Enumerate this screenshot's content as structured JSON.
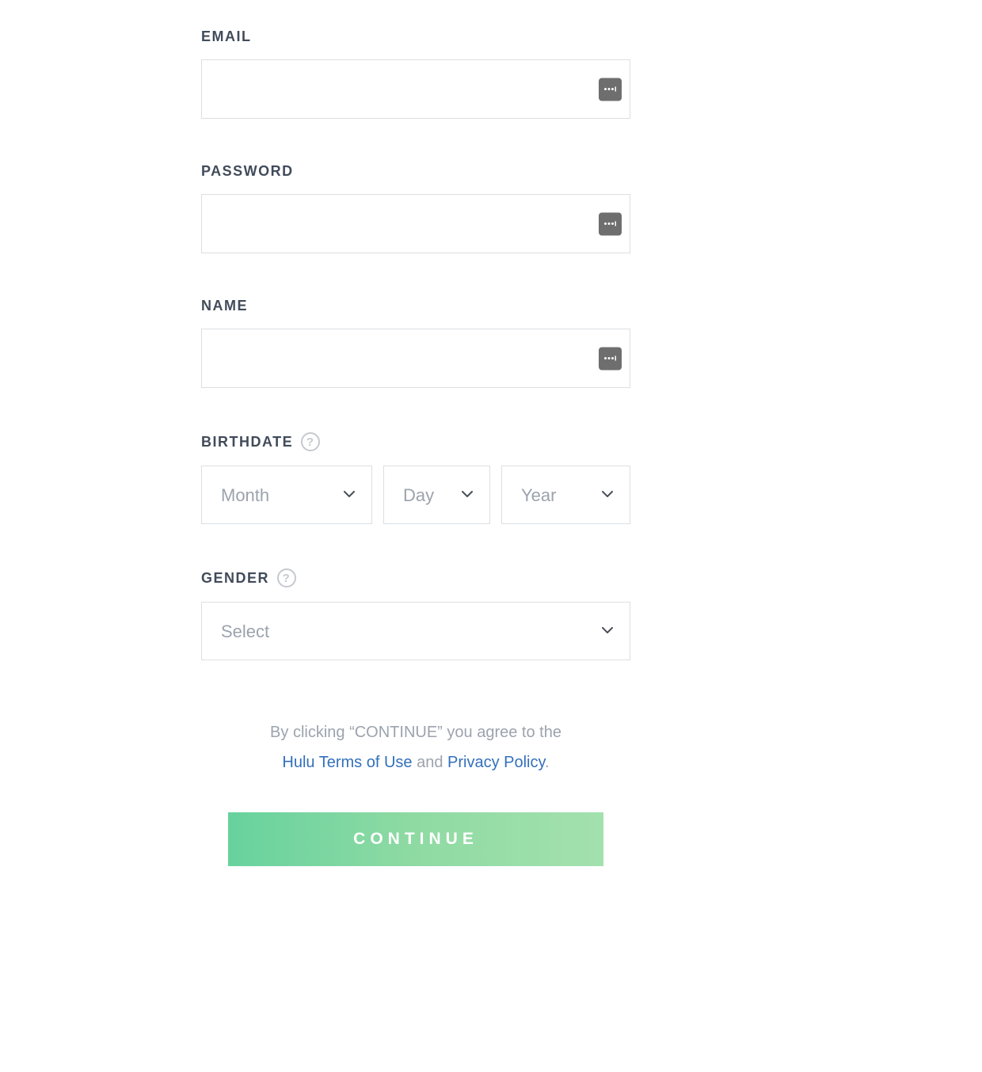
{
  "fields": {
    "email": {
      "label": "EMAIL",
      "value": ""
    },
    "password": {
      "label": "PASSWORD",
      "value": ""
    },
    "name": {
      "label": "NAME",
      "value": ""
    },
    "birthdate": {
      "label": "BIRTHDATE",
      "month": {
        "placeholder": "Month",
        "value": ""
      },
      "day": {
        "placeholder": "Day",
        "value": ""
      },
      "year": {
        "placeholder": "Year",
        "value": ""
      }
    },
    "gender": {
      "label": "GENDER",
      "placeholder": "Select",
      "value": ""
    }
  },
  "agreement": {
    "prefix": "By clicking “CONTINUE” you agree to the",
    "terms_link": "Hulu Terms of Use",
    "connector": " and ",
    "privacy_link": "Privacy Policy",
    "suffix": "."
  },
  "continue_label": "CONTINUE",
  "help_glyph": "?"
}
